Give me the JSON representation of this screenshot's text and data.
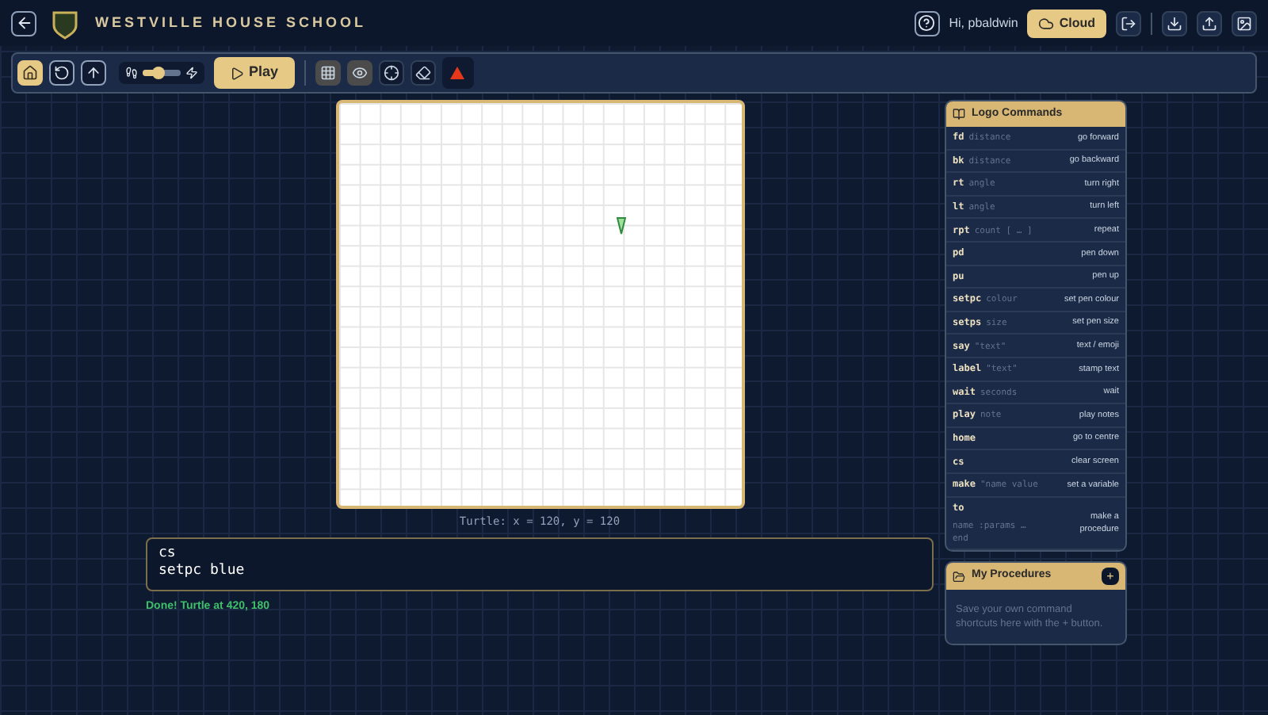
{
  "header": {
    "school_name": "WESTVILLE HOUSE SCHOOL",
    "greeting": "Hi, pbaldwin",
    "cloud_button": "Cloud"
  },
  "toolbar": {
    "nav_buttons": [
      {
        "kind": "home",
        "selected": true
      },
      {
        "kind": "reset",
        "selected": false
      },
      {
        "kind": "up",
        "selected": false
      }
    ],
    "speed": {
      "level": 0.4
    },
    "play_button": "Play",
    "view_buttons": [
      {
        "kind": "grid",
        "selected": true
      },
      {
        "kind": "eye",
        "selected": true
      },
      {
        "kind": "target",
        "selected": false
      },
      {
        "kind": "eraser",
        "selected": false
      }
    ]
  },
  "canvas": {
    "turtle_position": "Turtle: x = 120, y = 120"
  },
  "editor": {
    "value": "cs\nsetpc blue"
  },
  "status": "Done! Turtle at 420, 180",
  "logo_commands": {
    "title": "Logo Commands",
    "items": [
      {
        "command": "fd",
        "argument": "distance",
        "description": "go forward"
      },
      {
        "command": "bk",
        "argument": "distance",
        "description": "go backward"
      },
      {
        "command": "rt",
        "argument": "angle",
        "description": "turn right"
      },
      {
        "command": "lt",
        "argument": "angle",
        "description": "turn left"
      },
      {
        "command": "rpt",
        "argument": "count [ … ]",
        "description": "repeat"
      },
      {
        "command": "pd",
        "description": "pen down"
      },
      {
        "command": "pu",
        "description": "pen up"
      },
      {
        "command": "setpc",
        "argument": "colour",
        "description": "set pen colour"
      },
      {
        "command": "setps",
        "argument": "size",
        "description": "set pen size"
      },
      {
        "command": "say",
        "argument": "\"text\"",
        "description": "text / emoji"
      },
      {
        "command": "label",
        "argument": "\"text\"",
        "description": "stamp text"
      },
      {
        "command": "wait",
        "argument": "seconds",
        "description": "wait"
      },
      {
        "command": "play",
        "argument": "note",
        "description": "play notes"
      },
      {
        "command": "home",
        "description": "go to centre"
      },
      {
        "command": "cs",
        "description": "clear screen"
      },
      {
        "command": "make",
        "argument": "\"name value",
        "description": "set a variable"
      },
      {
        "command": "to",
        "argument": "name :params … end",
        "description": "make a procedure"
      }
    ]
  },
  "procedures": {
    "title": "My Procedures",
    "add_button": "+",
    "empty_text": "Save your own command shortcuts here with the + button."
  }
}
